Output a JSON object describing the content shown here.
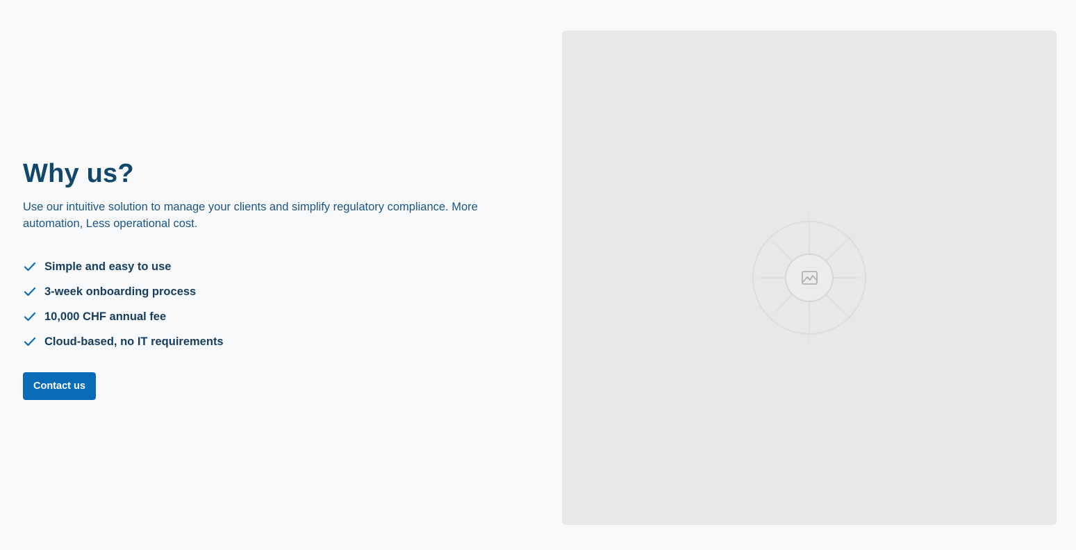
{
  "hero": {
    "title": "Why us?",
    "subtitle": "Use our intuitive solution to manage your clients and simplify regulatory compliance. More automation, Less operational cost.",
    "features": [
      {
        "icon": "check-icon",
        "label": "Simple and easy to use"
      },
      {
        "icon": "check-icon",
        "label": "3-week onboarding process"
      },
      {
        "icon": "check-icon",
        "label": "10,000 CHF annual fee"
      },
      {
        "icon": "check-icon",
        "label": "Cloud-based, no IT requirements"
      }
    ],
    "cta_label": "Contact us"
  },
  "media": {
    "icon": "image-placeholder-icon"
  },
  "colors": {
    "heading": "#12476b",
    "text": "#1b5580",
    "accent": "#0a6cb6",
    "background": "#f7f9fb",
    "placeholder": "#e8e8e8"
  }
}
